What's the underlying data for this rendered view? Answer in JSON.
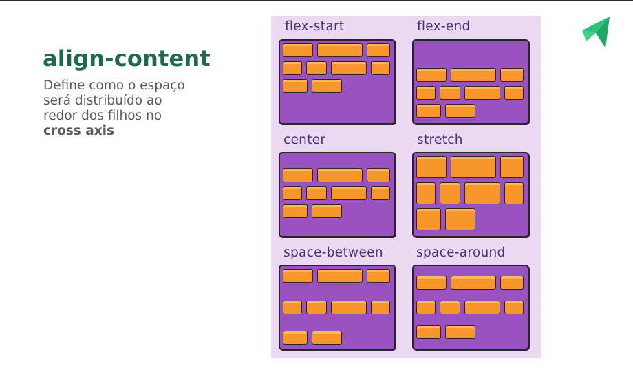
{
  "slide": {
    "title": "align-content",
    "description_line1": "Define como o espaço",
    "description_line2": "será distribuído ao",
    "description_line3": "redor dos filhos no",
    "description_bold": "cross axis"
  },
  "logo": {
    "icon": "paper-plane-logo-icon",
    "color": "#2ec27e"
  },
  "illustration": {
    "labels": [
      "flex-start",
      "flex-end",
      "center",
      "stretch",
      "space-between",
      "space-around"
    ],
    "colors": {
      "container": "#9a52c0",
      "item": "#f7962b",
      "background": "#ead9f0",
      "label": "#4a2f7a"
    }
  }
}
